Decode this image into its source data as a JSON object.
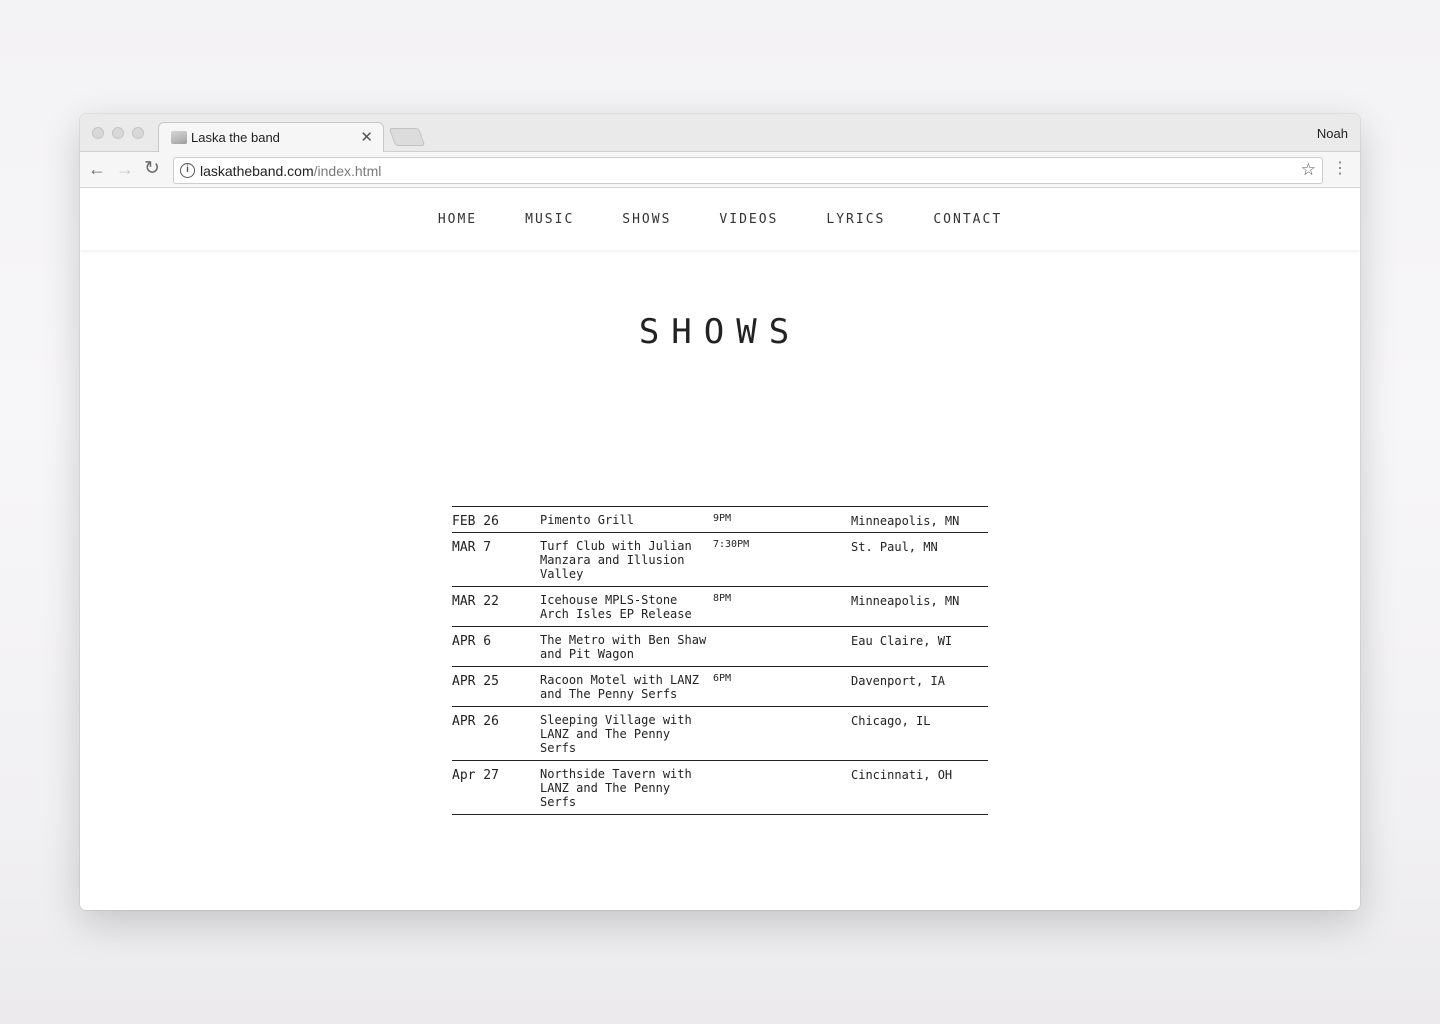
{
  "browser": {
    "tab_title": "Laska the band",
    "profile_name": "Noah",
    "url_host": "laskatheband.com",
    "url_path": "/index.html"
  },
  "nav": [
    "HOME",
    "MUSIC",
    "SHOWS",
    "VIDEOS",
    "LYRICS",
    "CONTACT"
  ],
  "page": {
    "heading": "SHOWS"
  },
  "shows": [
    {
      "date": "FEB 26",
      "venue": "Pimento Grill",
      "time": "9PM",
      "city": "Minneapolis, MN"
    },
    {
      "date": "MAR 7",
      "venue": "Turf Club with Julian Manzara and Illusion Valley",
      "time": "7:30PM",
      "city": "St. Paul, MN"
    },
    {
      "date": "MAR 22",
      "venue": "Icehouse MPLS-Stone Arch Isles EP Release",
      "time": "8PM",
      "city": "Minneapolis, MN"
    },
    {
      "date": "APR 6",
      "venue": "The Metro with Ben Shaw and Pit Wagon",
      "time": "",
      "city": "Eau Claire, WI"
    },
    {
      "date": "APR 25",
      "venue": "Racoon Motel with LANZ and The Penny Serfs",
      "time": "6PM",
      "city": "Davenport, IA"
    },
    {
      "date": "APR 26",
      "venue": "Sleeping Village with LANZ and The Penny Serfs",
      "time": "",
      "city": "Chicago, IL"
    },
    {
      "date": "Apr 27",
      "venue": "Northside Tavern with LANZ and The Penny Serfs",
      "time": "",
      "city": "Cincinnati, OH"
    }
  ]
}
